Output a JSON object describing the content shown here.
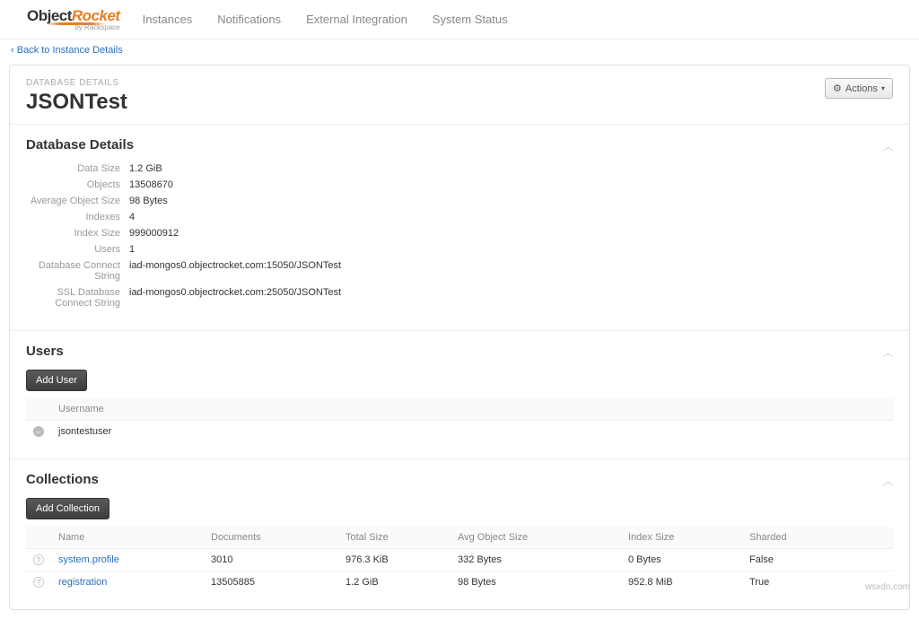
{
  "brand": {
    "part1": "Object",
    "part2": "Rocket",
    "by": "by Rackspace"
  },
  "nav": {
    "instances": "Instances",
    "notifications": "Notifications",
    "external": "External Integration",
    "status": "System Status"
  },
  "backlink": {
    "chevron": "‹",
    "label": "Back to Instance Details"
  },
  "header": {
    "breadcrumb": "DATABASE DETAILS",
    "title": "JSONTest",
    "actions": "Actions"
  },
  "details": {
    "heading": "Database Details",
    "labels": {
      "data_size": "Data Size",
      "objects": "Objects",
      "avg_obj": "Average Object Size",
      "indexes": "Indexes",
      "index_size": "Index Size",
      "users": "Users",
      "conn": "Database Connect String",
      "ssl_conn": "SSL Database Connect String"
    },
    "values": {
      "data_size": "1.2 GiB",
      "objects": "13508670",
      "avg_obj": "98 Bytes",
      "indexes": "4",
      "index_size": "999000912",
      "users": "1",
      "conn": "iad-mongos0.objectrocket.com:15050/JSONTest",
      "ssl_conn": "iad-mongos0.objectrocket.com:25050/JSONTest"
    }
  },
  "users": {
    "heading": "Users",
    "add_btn": "Add User",
    "col_username": "Username",
    "rows": [
      {
        "username": "jsontestuser"
      }
    ]
  },
  "collections": {
    "heading": "Collections",
    "add_btn": "Add Collection",
    "cols": {
      "name": "Name",
      "docs": "Documents",
      "total": "Total Size",
      "avg": "Avg Object Size",
      "idx": "Index Size",
      "sharded": "Sharded"
    },
    "rows": [
      {
        "name": "system.profile",
        "docs": "3010",
        "total": "976.3 KiB",
        "avg": "332 Bytes",
        "idx": "0 Bytes",
        "sharded": "False"
      },
      {
        "name": "registration",
        "docs": "13505885",
        "total": "1.2 GiB",
        "avg": "98 Bytes",
        "idx": "952.8 MiB",
        "sharded": "True"
      }
    ]
  },
  "watermark": "wsxdn.com"
}
